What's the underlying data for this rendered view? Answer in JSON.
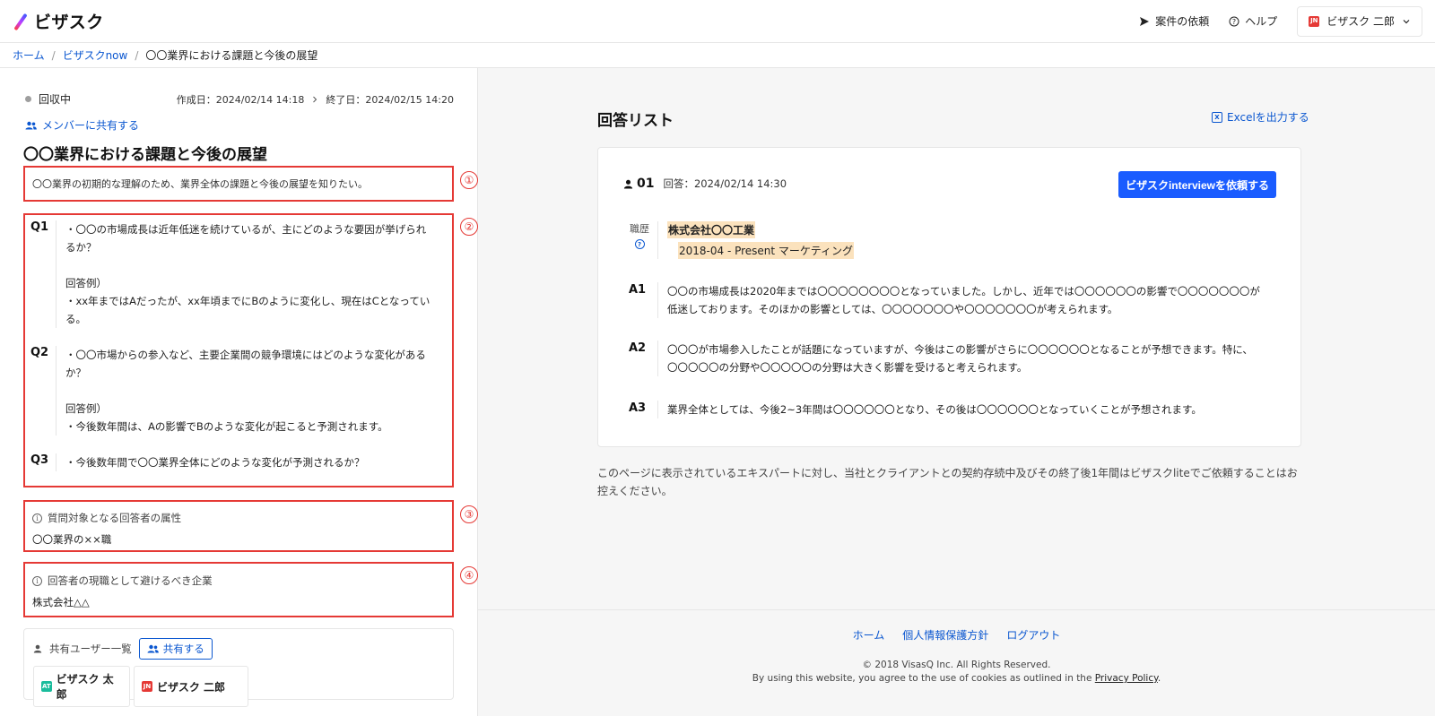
{
  "header": {
    "logo_text": "ビザスク",
    "links": [
      {
        "label": "案件の依頼",
        "icon": "send-icon"
      },
      {
        "label": "ヘルプ",
        "icon": "help-circle-icon"
      }
    ],
    "user": {
      "avatar_text": "JN",
      "avatar_color": "#e53935",
      "name": "ビザスク 二郎",
      "icon": "chevron-down-icon"
    }
  },
  "breadcrumb": {
    "items": [
      "ホーム",
      "ビザスクnow",
      "〇〇業界における課題と今後の展望"
    ]
  },
  "project": {
    "status": "回収中",
    "created": "作成日：2024/02/14 14:18",
    "ended": "終了日：2024/02/15 14:20",
    "share_members": "メンバーに共有する",
    "title": "〇〇業界における課題と今後の展望",
    "purpose": "〇〇業界の初期的な理解のため、業界全体の課題と今後の展望を知りたい。",
    "questions": [
      {
        "label": "Q1",
        "lines": [
          "・〇〇の市場成長は近年低迷を続けているが、主にどのような要因が挙げられ",
          "るか？",
          "",
          "回答例）",
          "・xx年まではAだったが、xx年頃までにBのように変化し、現在はCとなってい",
          "る。"
        ]
      },
      {
        "label": "Q2",
        "lines": [
          "・〇〇市場からの参入など、主要企業間の競争環境にはどのような変化がある",
          "か？",
          "",
          "回答例）",
          "・今後数年間は、Aの影響でBのような変化が起こると予測されます。"
        ]
      },
      {
        "label": "Q3",
        "lines": [
          "・今後数年間で〇〇業界全体にどのような変化が予測されるか？"
        ]
      }
    ],
    "target_attr_label": "質問対象となる回答者の属性",
    "target_attr_value": "〇〇業界の××職",
    "avoid_label": "回答者の現職として避けるべき企業",
    "avoid_value": "株式会社△△",
    "shared_users_label": "共有ユーザー一覧",
    "share_button": "共有する",
    "users": [
      {
        "name": "ビザスク 太郎",
        "avatar_text": "AT",
        "avatar_color": "#1abc9c"
      },
      {
        "name": "ビザスク 二郎",
        "avatar_text": "JN",
        "avatar_color": "#e53935"
      }
    ]
  },
  "annotations": [
    "①",
    "②",
    "③",
    "④"
  ],
  "answers": {
    "title": "回答リスト",
    "excel": "Excelを出力する",
    "item": {
      "number": "01",
      "date": "回答：2024/02/14 14:30",
      "request_button": "ビザスクinterviewを依頼する",
      "career_label": "職歴",
      "company": "株式会社〇〇工業",
      "position": "2018-04 - Present マーケティング",
      "rows": [
        {
          "label": "A1",
          "lines": [
            "〇〇の市場成長は2020年までは〇〇〇〇〇〇〇〇となっていました。しかし、近年では〇〇〇〇〇〇の影響で〇〇〇〇〇〇〇が",
            "低迷しております。そのほかの影響としては、〇〇〇〇〇〇〇や〇〇〇〇〇〇〇が考えられます。"
          ]
        },
        {
          "label": "A2",
          "lines": [
            "〇〇〇が市場参入したことが話題になっていますが、今後はこの影響がさらに〇〇〇〇〇〇となることが予想できます。特に、",
            "〇〇〇〇〇の分野や〇〇〇〇〇の分野は大きく影響を受けると考えられます。"
          ]
        },
        {
          "label": "A3",
          "lines": [
            "業界全体としては、今後2~3年間は〇〇〇〇〇〇となり、その後は〇〇〇〇〇〇となっていくことが予想されます。"
          ]
        }
      ]
    },
    "note_lines": [
      "このページに表示されているエキスパートに対し、当社とクライアントとの契約存続中及びその終了後1年間はビザスクliteでご依頼することはお",
      "控えください。"
    ]
  },
  "footer": {
    "links": [
      "ホーム",
      "個人情報保護方針",
      "ログアウト"
    ],
    "copyright": "© 2018 VisasQ Inc. All Rights Reserved.",
    "cookie_text": "By using this website, you agree to the use of cookies as outlined in the",
    "privacy_link": "Privacy Policy",
    "cookie_end": "."
  },
  "colors": {
    "accent": "#0b57d0",
    "primary_button": "#1a5cff",
    "annotation": "#e53935",
    "highlight": "#fbe2bd"
  }
}
